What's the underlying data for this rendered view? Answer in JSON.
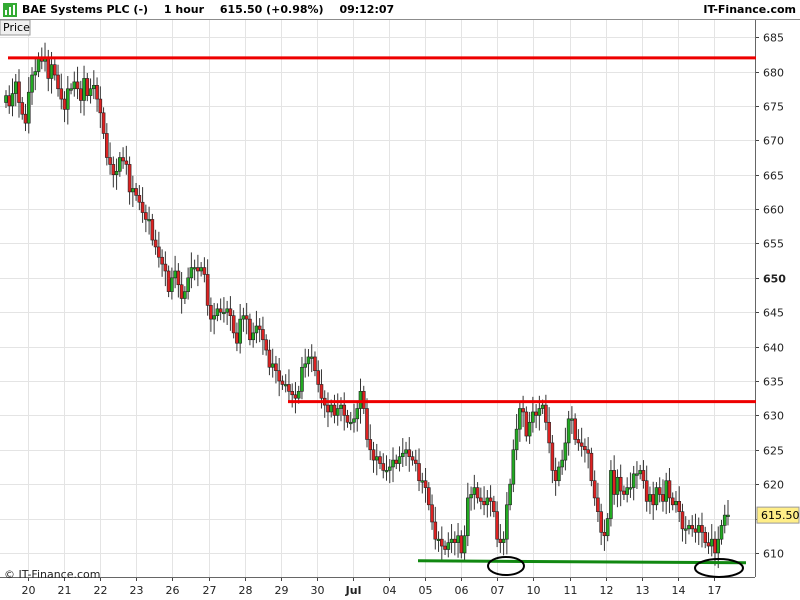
{
  "header": {
    "instrument": "BAE Systems PLC (-)",
    "timeframe": "1 hour",
    "price_change": "615.50 (+0.98%)",
    "time": "09:12:07",
    "brand": "IT-Finance.com",
    "app_icon": "bar-chart-icon"
  },
  "panel_label": "Price",
  "watermark": "© IT-Finance.com",
  "current_price_label": "615.50",
  "colors": {
    "up": "#22aa22",
    "down": "#dd2222",
    "resistance": "#ee0000",
    "support": "#118811",
    "marker": "#000000",
    "price_tag": "#ffee88"
  },
  "chart_data": {
    "type": "candlestick",
    "title": "BAE Systems PLC (-)",
    "timeframe": "1 hour",
    "ylim": [
      606.5,
      687.5
    ],
    "y_ticks": [
      610,
      615,
      620,
      625,
      630,
      635,
      640,
      645,
      650,
      655,
      660,
      665,
      670,
      675,
      680,
      685
    ],
    "y_tick_bold": [
      650
    ],
    "x_labels": [
      "20",
      "21",
      "22",
      "23",
      "26",
      "27",
      "28",
      "29",
      "30",
      "Jul",
      "04",
      "05",
      "06",
      "07",
      "10",
      "11",
      "12",
      "13",
      "14",
      "17"
    ],
    "grid": true,
    "close_series": [
      676.5,
      675,
      676.8,
      678.5,
      675.5,
      673.8,
      672.5,
      677,
      679.5,
      680,
      682,
      681.5,
      682,
      679,
      681,
      679.5,
      677.5,
      676,
      674.5,
      677.5,
      677.5,
      678.5,
      677.5,
      675.8,
      679,
      676.5,
      677.5,
      678,
      676,
      674,
      671,
      667.5,
      666.5,
      665,
      665.5,
      667.5,
      667,
      666.5,
      662.5,
      663,
      662,
      661,
      659.5,
      658.5,
      658.5,
      655.5,
      654.5,
      653,
      652,
      651,
      648,
      650,
      651,
      649,
      647,
      648,
      650,
      651.5,
      651.5,
      651,
      651.5,
      650.5,
      646,
      644,
      644.5,
      645.5,
      645,
      645,
      645.5,
      644.5,
      642,
      640.5,
      644,
      644.5,
      644,
      641,
      642,
      643,
      642.5,
      641,
      639.5,
      637,
      637.5,
      636.5,
      635,
      634.5,
      634.5,
      633.5,
      633,
      632.5,
      633.5,
      637,
      637.5,
      638.5,
      638.5,
      636.5,
      634.5,
      632.5,
      631.5,
      630.5,
      631.5,
      630,
      631,
      631.5,
      630,
      629,
      629,
      629.5,
      631,
      633.5,
      631,
      626.5,
      625,
      623.5,
      624,
      623,
      622,
      622,
      622.5,
      623.5,
      623,
      624,
      624.5,
      625,
      624,
      623.5,
      623,
      620.5,
      620.5,
      619.5,
      617,
      614.5,
      612,
      612,
      611,
      610.5,
      611.5,
      612,
      611.5,
      612.5,
      610,
      612.5,
      618,
      618.5,
      619.5,
      618,
      617.5,
      617,
      618,
      617.5,
      616,
      612,
      611.5,
      612,
      617,
      620,
      625,
      628,
      631,
      630.5,
      627,
      629,
      630.5,
      630,
      631,
      631.5,
      629,
      626,
      622,
      620.5,
      622.5,
      623.5,
      626,
      629.5,
      629.5,
      626.5,
      626,
      625.5,
      625,
      624.5,
      620.5,
      618,
      616,
      613,
      612.5,
      615,
      622,
      618.5,
      621,
      619,
      618.5,
      619.5,
      619.5,
      621.5,
      621.5,
      622,
      620.5,
      617.5,
      618.5,
      617,
      619.5,
      618.5,
      617.5,
      620.5,
      618,
      617,
      617.5,
      616,
      613.5,
      613.5,
      614,
      613.5,
      613,
      614,
      613,
      611.5,
      611,
      612,
      610,
      612,
      614,
      615.5,
      615.5
    ],
    "resistance_levels": [
      682,
      632
    ],
    "support_level": 609,
    "current_price": 615.5
  }
}
